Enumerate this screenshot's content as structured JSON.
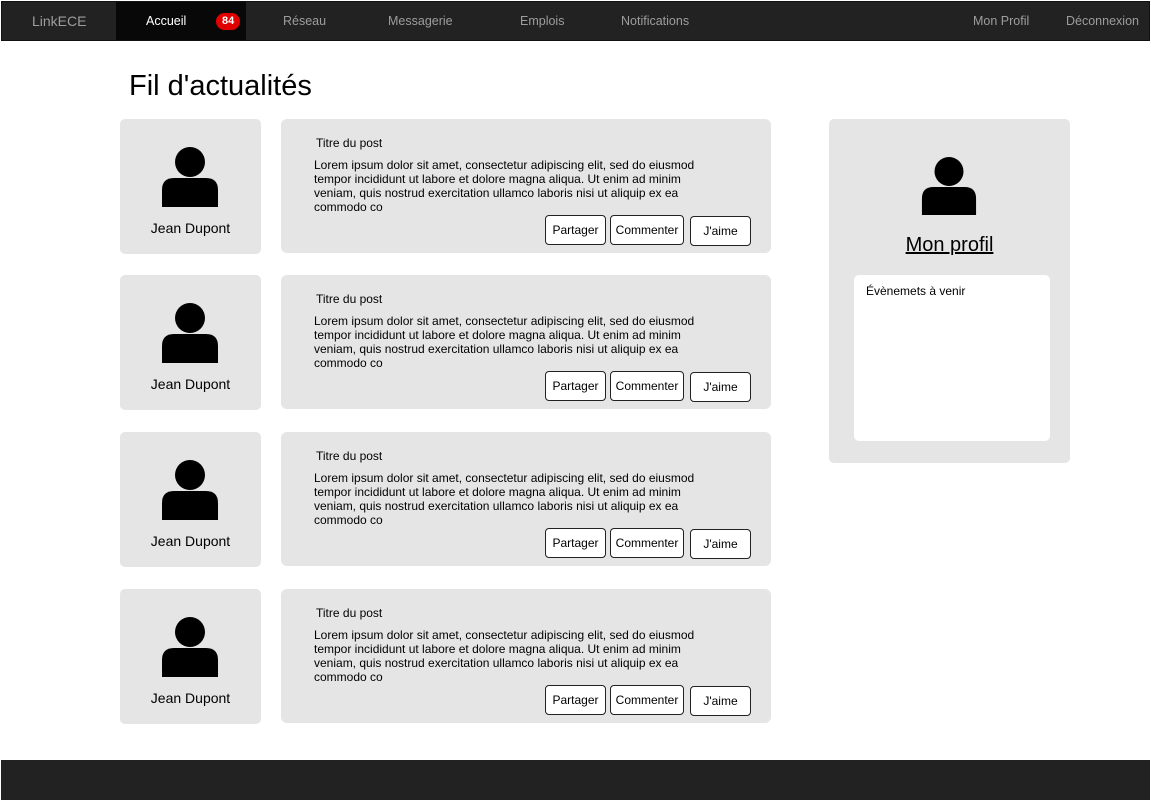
{
  "nav": {
    "brand": "LinkECE",
    "items": [
      {
        "label": "Accueil",
        "badge": "84"
      },
      {
        "label": "Réseau"
      },
      {
        "label": "Messagerie"
      },
      {
        "label": "Emplois"
      },
      {
        "label": "Notifications"
      },
      {
        "label": "Mon Profil"
      },
      {
        "label": "Déconnexion"
      }
    ]
  },
  "page_title": "Fil d'actualités",
  "posts": [
    {
      "author": "Jean Dupont",
      "title": "Titre du post",
      "body": "Lorem ipsum dolor sit amet, consectetur adipiscing elit, sed do eiusmod tempor incididunt ut labore et dolore magna aliqua. Ut enim ad minim veniam, quis nostrud exercitation ullamco laboris nisi ut aliquip ex ea commodo co",
      "share_label": "Partager",
      "comment_label": "Commenter",
      "like_label": "J'aime"
    },
    {
      "author": "Jean Dupont",
      "title": "Titre du post",
      "body": "Lorem ipsum dolor sit amet, consectetur adipiscing elit, sed do eiusmod tempor incididunt ut labore et dolore magna aliqua. Ut enim ad minim veniam, quis nostrud exercitation ullamco laboris nisi ut aliquip ex ea commodo co",
      "share_label": "Partager",
      "comment_label": "Commenter",
      "like_label": "J'aime"
    },
    {
      "author": "Jean Dupont",
      "title": "Titre du post",
      "body": "Lorem ipsum dolor sit amet, consectetur adipiscing elit, sed do eiusmod tempor incididunt ut labore et dolore magna aliqua. Ut enim ad minim veniam, quis nostrud exercitation ullamco laboris nisi ut aliquip ex ea commodo co",
      "share_label": "Partager",
      "comment_label": "Commenter",
      "like_label": "J'aime"
    },
    {
      "author": "Jean Dupont",
      "title": "Titre du post",
      "body": "Lorem ipsum dolor sit amet, consectetur adipiscing elit, sed do eiusmod tempor incididunt ut labore et dolore magna aliqua. Ut enim ad minim veniam, quis nostrud exercitation ullamco laboris nisi ut aliquip ex ea commodo co",
      "share_label": "Partager",
      "comment_label": "Commenter",
      "like_label": "J'aime"
    }
  ],
  "sidebar": {
    "profile_link": "Mon profil",
    "events_title": "Évènemets à venir"
  },
  "colors": {
    "navbar": "#222222",
    "nav_active": "#080808",
    "badge": "#e10000",
    "card": "#e5e5e5"
  },
  "icons": {
    "avatar": "user-silhouette-icon"
  }
}
